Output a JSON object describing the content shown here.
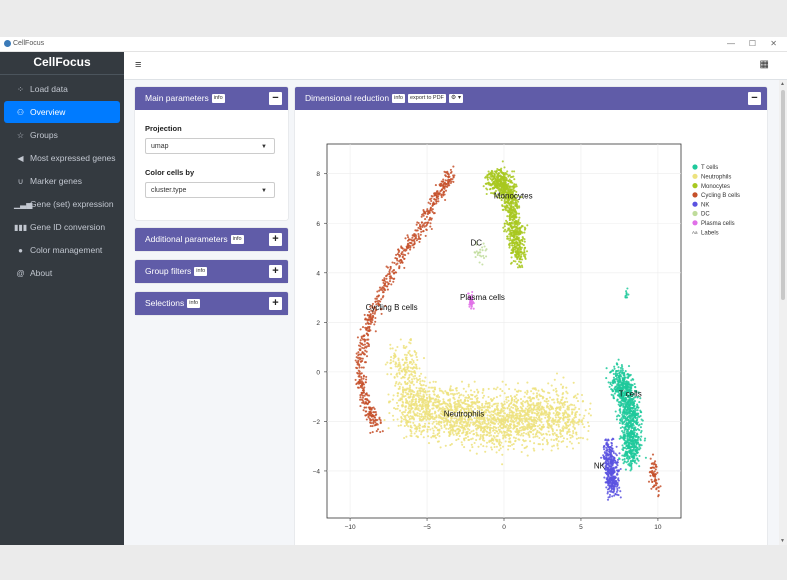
{
  "window": {
    "title": "CellFocus",
    "controls": [
      "—",
      "☐",
      "✕"
    ]
  },
  "sidebar": {
    "brand": "CellFocus",
    "items": [
      {
        "label": "Load data",
        "icon": "spinner-icon",
        "glyph": "⁘",
        "active": false
      },
      {
        "label": "Overview",
        "icon": "binoculars-icon",
        "glyph": "⚇",
        "active": true
      },
      {
        "label": "Groups",
        "icon": "star-icon",
        "glyph": "☆",
        "active": false
      },
      {
        "label": "Most expressed genes",
        "icon": "bullhorn-icon",
        "glyph": "◀",
        "active": false
      },
      {
        "label": "Marker genes",
        "icon": "magnet-icon",
        "glyph": "∪",
        "active": false
      },
      {
        "label": "Gene (set) expression",
        "icon": "signal-icon",
        "glyph": "▁▃▅",
        "active": false
      },
      {
        "label": "Gene ID conversion",
        "icon": "barcode-icon",
        "glyph": "▮▮▮",
        "active": false
      },
      {
        "label": "Color management",
        "icon": "palette-icon",
        "glyph": "●",
        "active": false
      },
      {
        "label": "About",
        "icon": "at-icon",
        "glyph": "@",
        "active": false
      }
    ]
  },
  "topbar": {
    "menu_glyph": "≡",
    "grid_glyph": "▦"
  },
  "main_params": {
    "title": "Main parameters",
    "info": "info",
    "collapse": "−",
    "projection_label": "Projection",
    "projection_value": "umap",
    "color_label": "Color cells by",
    "color_value": "cluster.type",
    "caret": "▼"
  },
  "additional_params": {
    "title": "Additional parameters",
    "info": "info",
    "expand": "+"
  },
  "group_filters": {
    "title": "Group filters",
    "info": "info",
    "expand": "+"
  },
  "selections": {
    "title": "Selections",
    "info": "info",
    "expand": "+"
  },
  "dimred": {
    "title": "Dimensional reduction",
    "info": "info",
    "export": "export to PDF",
    "gear": "⚙ ▾",
    "collapse": "−"
  },
  "chart_data": {
    "type": "scatter",
    "xlim": [
      -11.5,
      11.5
    ],
    "ylim": [
      -5.9,
      9.2
    ],
    "xticks": [
      -10,
      -5,
      0,
      5,
      10
    ],
    "yticks": [
      -4,
      -2,
      0,
      2,
      4,
      6,
      8
    ],
    "xtick_labels": [
      "−10",
      "−5",
      "0",
      "5",
      "10"
    ],
    "ytick_labels": [
      "−4",
      "−2",
      "0",
      "2",
      "4",
      "6",
      "8"
    ],
    "grid": true,
    "legend_position": "right",
    "legend": [
      {
        "name": "T cells",
        "color": "#1fc99b"
      },
      {
        "name": "Neutrophils",
        "color": "#ede27e"
      },
      {
        "name": "Monocytes",
        "color": "#a8c820"
      },
      {
        "name": "Cycling B cells",
        "color": "#c5502a"
      },
      {
        "name": "NK",
        "color": "#5b52e0"
      },
      {
        "name": "DC",
        "color": "#bfdc9b"
      },
      {
        "name": "Plasma cells",
        "color": "#e070e8"
      }
    ],
    "legend_labels_entry": {
      "marker": "Aa",
      "name": "Labels"
    },
    "cluster_labels": [
      {
        "text": "Monocytes",
        "x": 0.6,
        "y": 7.0
      },
      {
        "text": "DC",
        "x": -1.8,
        "y": 5.1
      },
      {
        "text": "Plasma cells",
        "x": -1.4,
        "y": 2.9
      },
      {
        "text": "Cycling B cells",
        "x": -7.3,
        "y": 2.5
      },
      {
        "text": "Neutrophils",
        "x": -2.6,
        "y": -1.8
      },
      {
        "text": "T cells",
        "x": 8.2,
        "y": -1.0
      },
      {
        "text": "NK",
        "x": 6.2,
        "y": -3.9
      }
    ],
    "clusters": [
      {
        "name": "Cycling B cells",
        "color": "#c5502a",
        "n": 700,
        "spread": 0.3,
        "path": [
          [
            -3.4,
            7.9
          ],
          [
            -4.3,
            7.2
          ],
          [
            -5.3,
            5.8
          ],
          [
            -6.6,
            4.8
          ],
          [
            -7.8,
            3.3
          ],
          [
            -8.8,
            2.0
          ],
          [
            -9.4,
            0.3
          ],
          [
            -9.0,
            -1.3
          ],
          [
            -8.2,
            -2.2
          ]
        ]
      },
      {
        "name": "Cycling B cells",
        "color": "#c5502a",
        "n": 70,
        "spread": 0.22,
        "path": [
          [
            9.7,
            -3.6
          ],
          [
            9.9,
            -4.8
          ]
        ]
      },
      {
        "name": "Monocytes",
        "color": "#a8c820",
        "n": 900,
        "spread": 0.45,
        "path": [
          [
            -0.8,
            7.8
          ],
          [
            0.3,
            7.5
          ],
          [
            0.6,
            6.0
          ],
          [
            1.0,
            4.6
          ]
        ]
      },
      {
        "name": "DC",
        "color": "#bfdc9b",
        "n": 25,
        "spread": 0.35,
        "path": [
          [
            -1.8,
            5.2
          ],
          [
            -1.4,
            4.7
          ]
        ]
      },
      {
        "name": "Plasma cells",
        "color": "#e070e8",
        "n": 40,
        "spread": 0.12,
        "path": [
          [
            -2.2,
            3.2
          ],
          [
            -2.1,
            2.6
          ]
        ]
      },
      {
        "name": "Neutrophils",
        "color": "#ede27e",
        "n": 2200,
        "spread": 0.95,
        "path": [
          [
            -6.6,
            -1.2
          ],
          [
            -5.0,
            -1.5
          ],
          [
            -3.0,
            -1.7
          ],
          [
            -1.2,
            -2.0
          ],
          [
            0.5,
            -1.9
          ],
          [
            2.4,
            -1.7
          ],
          [
            4.8,
            -1.8
          ]
        ]
      },
      {
        "name": "T cells",
        "color": "#1fc99b",
        "n": 1000,
        "spread": 0.55,
        "path": [
          [
            7.4,
            -0.2
          ],
          [
            7.9,
            -0.8
          ],
          [
            8.2,
            -1.6
          ],
          [
            8.3,
            -2.6
          ],
          [
            8.2,
            -3.5
          ]
        ]
      },
      {
        "name": "T cells",
        "color": "#1fc99b",
        "n": 10,
        "spread": 0.1,
        "path": [
          [
            8.0,
            3.3
          ],
          [
            8.0,
            3.0
          ]
        ]
      },
      {
        "name": "NK",
        "color": "#5b52e0",
        "n": 380,
        "spread": 0.38,
        "path": [
          [
            6.8,
            -3.0
          ],
          [
            7.0,
            -4.0
          ],
          [
            7.1,
            -4.7
          ]
        ]
      },
      {
        "name": "Neutrophils",
        "color": "#ede27e",
        "n": 160,
        "spread": 0.6,
        "path": [
          [
            -7.2,
            0.6
          ],
          [
            -5.9,
            0.4
          ],
          [
            -6.6,
            -0.5
          ]
        ]
      }
    ]
  }
}
